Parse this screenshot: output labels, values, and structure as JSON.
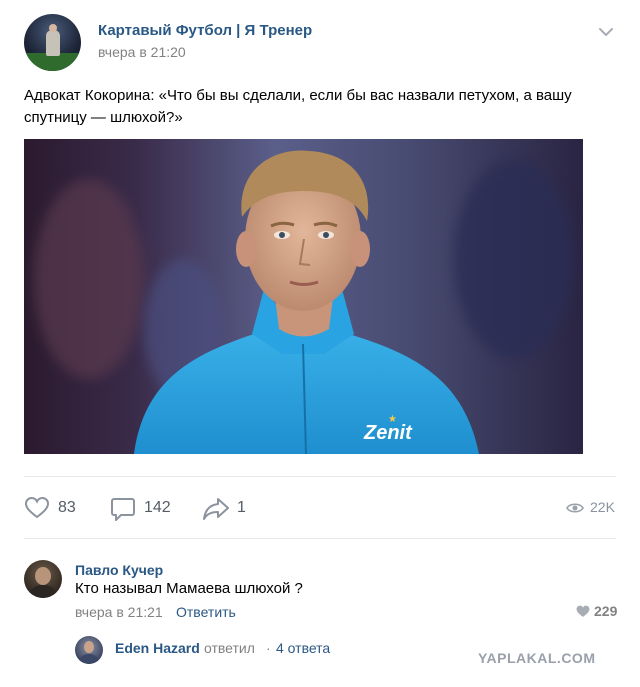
{
  "post": {
    "group_name": "Картавый Футбол | Я Тренер",
    "time": "вчера в 21:20",
    "text": "Адвокат Кокорина: «Что бы вы сделали, если бы вас назвали петухом, а вашу спутницу — шлюхой?»",
    "photo_logo": "Zenit"
  },
  "actions": {
    "likes": "83",
    "comments": "142",
    "shares": "1",
    "views": "22K"
  },
  "comment": {
    "author": "Павло Кучер",
    "text": "Кто называл Мамаева шлюхой ?",
    "time": "вчера в 21:21",
    "reply_label": "Ответить",
    "likes": "229"
  },
  "reply_thread": {
    "author": "Eden Hazard",
    "action": "ответил",
    "separator": "·",
    "count": "4 ответа"
  },
  "watermark": "YAPLAKAL.COM",
  "colors": {
    "link": "#2a5885",
    "secondary": "#828282",
    "jersey": "#2ca3e0"
  },
  "icons": [
    "chevron-down-icon",
    "heart-icon",
    "comment-icon",
    "share-icon",
    "eye-icon"
  ]
}
